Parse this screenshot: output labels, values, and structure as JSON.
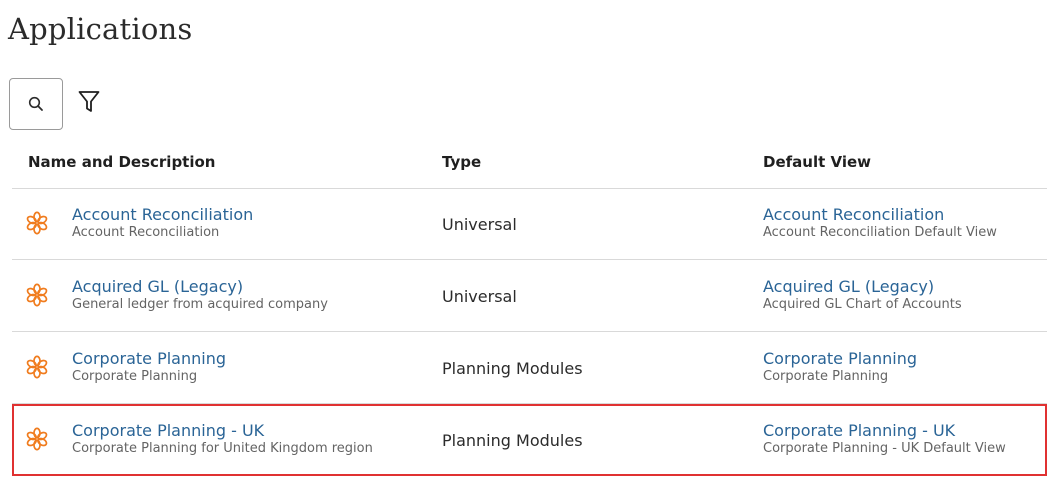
{
  "page": {
    "title": "Applications"
  },
  "toolbar": {
    "search_icon": "search-icon",
    "filter_icon": "filter-icon"
  },
  "table": {
    "columns": [
      "Name and Description",
      "Type",
      "Default View"
    ],
    "rows": [
      {
        "name": "Account Reconciliation",
        "description": "Account Reconciliation",
        "type": "Universal",
        "default_view": "Account Reconciliation",
        "default_view_description": "Account Reconciliation Default View",
        "selected": false
      },
      {
        "name": "Acquired GL (Legacy)",
        "description": "General ledger from acquired company",
        "type": "Universal",
        "default_view": "Acquired GL (Legacy)",
        "default_view_description": "Acquired GL Chart of Accounts",
        "selected": false
      },
      {
        "name": "Corporate Planning",
        "description": "Corporate Planning",
        "type": "Planning Modules",
        "default_view": "Corporate Planning",
        "default_view_description": "Corporate Planning",
        "selected": false
      },
      {
        "name": "Corporate Planning - UK",
        "description": "Corporate Planning for United Kingdom region",
        "type": "Planning Modules",
        "default_view": "Corporate Planning - UK",
        "default_view_description": "Corporate Planning - UK Default View",
        "selected": true
      }
    ]
  },
  "colors": {
    "link": "#2a6496",
    "icon": "#f07c1e",
    "selection_border": "#e03131",
    "divider": "#d9d9d9"
  }
}
